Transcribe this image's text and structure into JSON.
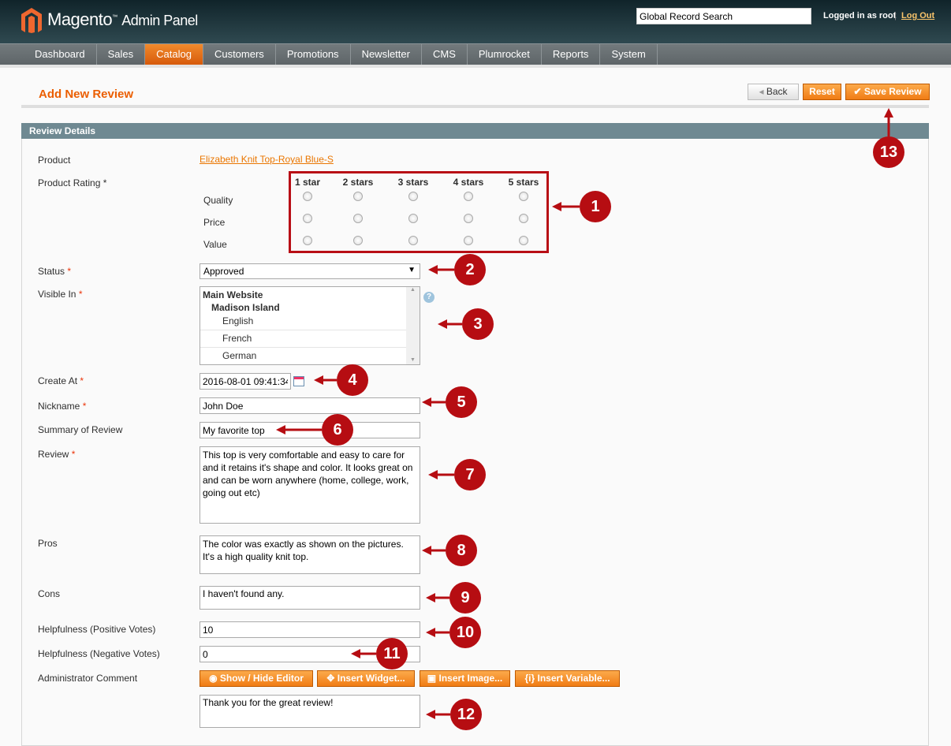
{
  "header": {
    "logo": "Magento",
    "logo_suffix": "Admin Panel",
    "search_placeholder": "Global Record Search",
    "logged_in": "Logged in as root",
    "separator": "|",
    "logout": "Log Out"
  },
  "nav": [
    "Dashboard",
    "Sales",
    "Catalog",
    "Customers",
    "Promotions",
    "Newsletter",
    "CMS",
    "Plumrocket",
    "Reports",
    "System"
  ],
  "nav_active": "Catalog",
  "page": {
    "title": "Add New Review",
    "back": "Back",
    "reset": "Reset",
    "save": "Save Review",
    "section": "Review Details"
  },
  "form": {
    "product_label": "Product",
    "product_value": "Elizabeth Knit Top-Royal Blue-S",
    "rating_label": "Product Rating",
    "rating_cols": [
      "1 star",
      "2 stars",
      "3 stars",
      "4 stars",
      "5 stars"
    ],
    "rating_rows": [
      "Quality",
      "Price",
      "Value"
    ],
    "status_label": "Status",
    "status_value": "Approved",
    "visible_label": "Visible In",
    "visible_options": [
      "Main Website",
      "Madison Island",
      "English",
      "French",
      "German"
    ],
    "create_label": "Create At",
    "create_value": "2016-08-01 09:41:34",
    "nickname_label": "Nickname",
    "nickname_value": "John Doe",
    "summary_label": "Summary of Review",
    "summary_value": "My favorite top",
    "review_label": "Review",
    "review_value": "This top is very comfortable and easy to care for and it retains it's shape and color. It looks great on and can be worn anywhere (home, college, work, going out etc)",
    "pros_label": "Pros",
    "pros_value": "The color was exactly as shown on the pictures. It's a high quality knit top.",
    "cons_label": "Cons",
    "cons_value": "I haven't found any.",
    "pos_label": "Helpfulness (Positive Votes)",
    "pos_value": "10",
    "neg_label": "Helpfulness (Negative Votes)",
    "neg_value": "0",
    "comment_label": "Administrator Comment",
    "comment_buttons": [
      "Show / Hide Editor",
      "Insert Widget...",
      "Insert Image...",
      "Insert Variable..."
    ],
    "comment_value": "Thank you for the great review!",
    "required_mark": "*"
  },
  "callouts": [
    "1",
    "2",
    "3",
    "4",
    "5",
    "6",
    "7",
    "8",
    "9",
    "10",
    "11",
    "12",
    "13"
  ],
  "colors": {
    "accent": "#eb5e00",
    "callout": "#b60d12",
    "section": "#6f8992"
  }
}
